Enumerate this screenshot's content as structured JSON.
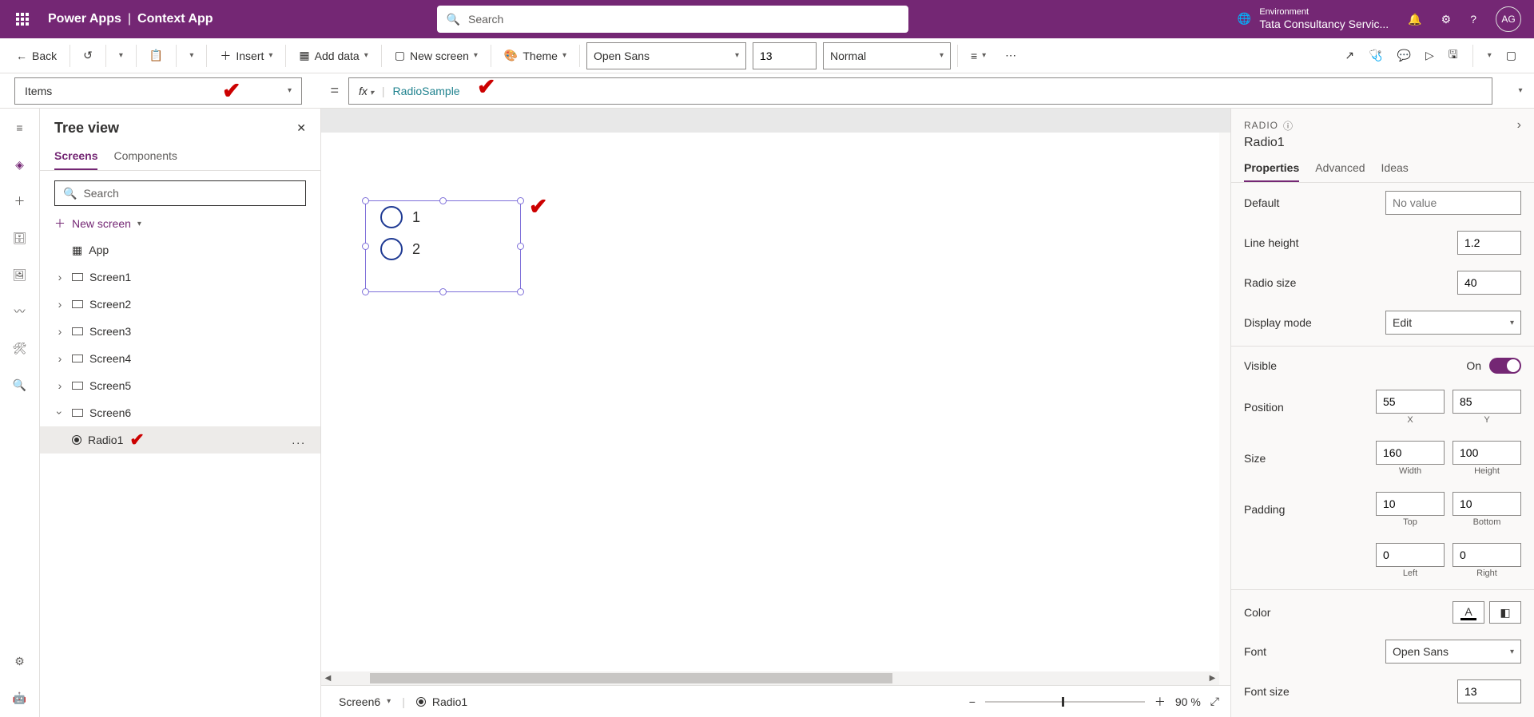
{
  "header": {
    "brand": "Power Apps",
    "app_name": "Context App",
    "search_placeholder": "Search",
    "env_label": "Environment",
    "env_value": "Tata Consultancy Servic...",
    "user_initials": "AG"
  },
  "commandbar": {
    "back": "Back",
    "insert": "Insert",
    "add_data": "Add data",
    "new_screen": "New screen",
    "theme": "Theme",
    "font": "Open Sans",
    "font_size": "13",
    "font_weight": "Normal"
  },
  "formula": {
    "property": "Items",
    "equals": "=",
    "fx": "fx",
    "value": "RadioSample"
  },
  "tree": {
    "title": "Tree view",
    "tab_screens": "Screens",
    "tab_components": "Components",
    "search_placeholder": "Search",
    "new_screen": "New screen",
    "app": "App",
    "screens": [
      "Screen1",
      "Screen2",
      "Screen3",
      "Screen4",
      "Screen5",
      "Screen6"
    ],
    "radio_item": "Radio1",
    "more": "..."
  },
  "canvas": {
    "radio_options": [
      "1",
      "2"
    ],
    "status_screen": "Screen6",
    "status_control": "Radio1",
    "zoom": "90  %"
  },
  "props": {
    "type": "RADIO",
    "name": "Radio1",
    "tab_properties": "Properties",
    "tab_advanced": "Advanced",
    "tab_ideas": "Ideas",
    "default_label": "Default",
    "default_placeholder": "No value",
    "lineheight_label": "Line height",
    "lineheight": "1.2",
    "radiosize_label": "Radio size",
    "radiosize": "40",
    "displaymode_label": "Display mode",
    "displaymode": "Edit",
    "visible_label": "Visible",
    "visible_on": "On",
    "position_label": "Position",
    "pos_x": "55",
    "pos_y": "85",
    "lbl_x": "X",
    "lbl_y": "Y",
    "size_label": "Size",
    "width": "160",
    "height": "100",
    "lbl_width": "Width",
    "lbl_height": "Height",
    "padding_label": "Padding",
    "pad_top": "10",
    "pad_bottom": "10",
    "pad_left": "0",
    "pad_right": "0",
    "lbl_top": "Top",
    "lbl_bottom": "Bottom",
    "lbl_left": "Left",
    "lbl_right": "Right",
    "color_label": "Color",
    "font_label": "Font",
    "font_value": "Open Sans",
    "fontsize_label": "Font size",
    "fontsize": "13"
  }
}
